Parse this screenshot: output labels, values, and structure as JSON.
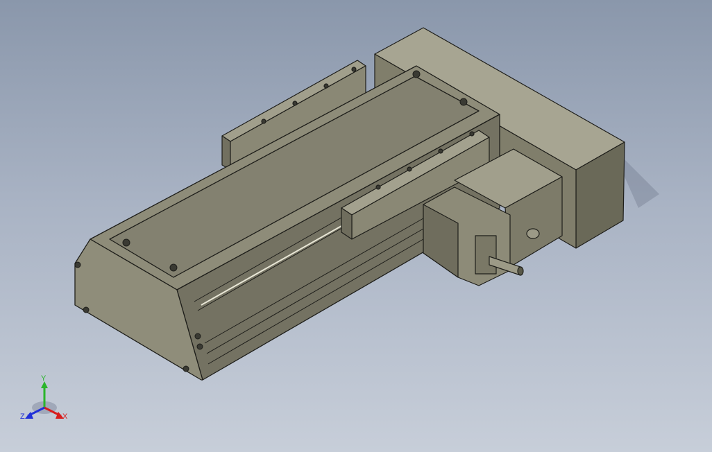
{
  "viewport": {
    "background_top": "#8a97ab",
    "background_bottom": "#c7ced9",
    "model_fill": "#8b8a77",
    "model_edge": "#1e1e1a"
  },
  "triad": {
    "x_label": "X",
    "y_label": "Y",
    "z_label": "Z",
    "x_color": "#d81c1c",
    "y_color": "#2bb52b",
    "z_color": "#2030d8"
  }
}
